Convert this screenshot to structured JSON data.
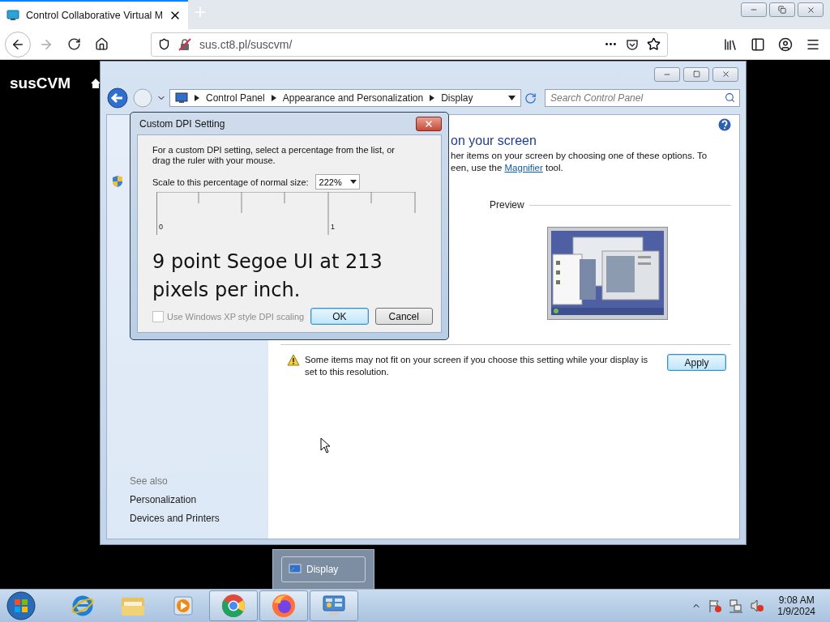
{
  "browser": {
    "tabs": [
      {
        "title": "Control Collaborative Virtual M",
        "selected": true
      }
    ],
    "forward_disabled": true,
    "url": "sus.ct8.pl/suscvm/"
  },
  "page": {
    "brand": "susCVM"
  },
  "window": {
    "breadcrumbs": [
      "Control Panel",
      "Appearance and Personalization",
      "Display"
    ],
    "search": {
      "placeholder": "Search Control Panel"
    },
    "see_also": {
      "title": "See also",
      "links": [
        "Personalization",
        "Devices and Printers"
      ]
    },
    "heading": "on your screen",
    "line_1": "her items on your screen by choosing one of these options. To",
    "line_2_start": "een, use the",
    "link": "Magnifier",
    "line_2_end": "tool.",
    "preview_label": "Preview",
    "warning": "Some items may not fit on your screen if you choose this setting while your display is set to this resolution.",
    "apply": "Apply"
  },
  "dialog": {
    "title": "Custom DPI Setting",
    "instructions": "For a custom DPI setting, select a percentage from the list, or drag the ruler with your mouse.",
    "scale_label": "Scale to this percentage of normal size:",
    "scale_value": "222%",
    "ruler_labels": [
      "0",
      "1"
    ],
    "sample": "9 point Segoe UI at 213 pixels per inch.",
    "xp_scaling": {
      "label": "Use Windows XP style DPI scaling",
      "checked": false,
      "disabled": true
    },
    "buttons": [
      {
        "label": "OK",
        "default": true
      },
      {
        "label": "Cancel",
        "default": false
      }
    ]
  },
  "taskbar": {
    "thumbnail": "Display",
    "apps": [
      {
        "kind": "ie",
        "open": false
      },
      {
        "kind": "explorer",
        "open": false
      },
      {
        "kind": "media",
        "open": false
      },
      {
        "kind": "chrome",
        "open": true
      },
      {
        "kind": "firefox",
        "open": true
      },
      {
        "kind": "control",
        "open": true
      }
    ],
    "clock": {
      "time": "9:08 AM",
      "date": "1/9/2024"
    }
  }
}
